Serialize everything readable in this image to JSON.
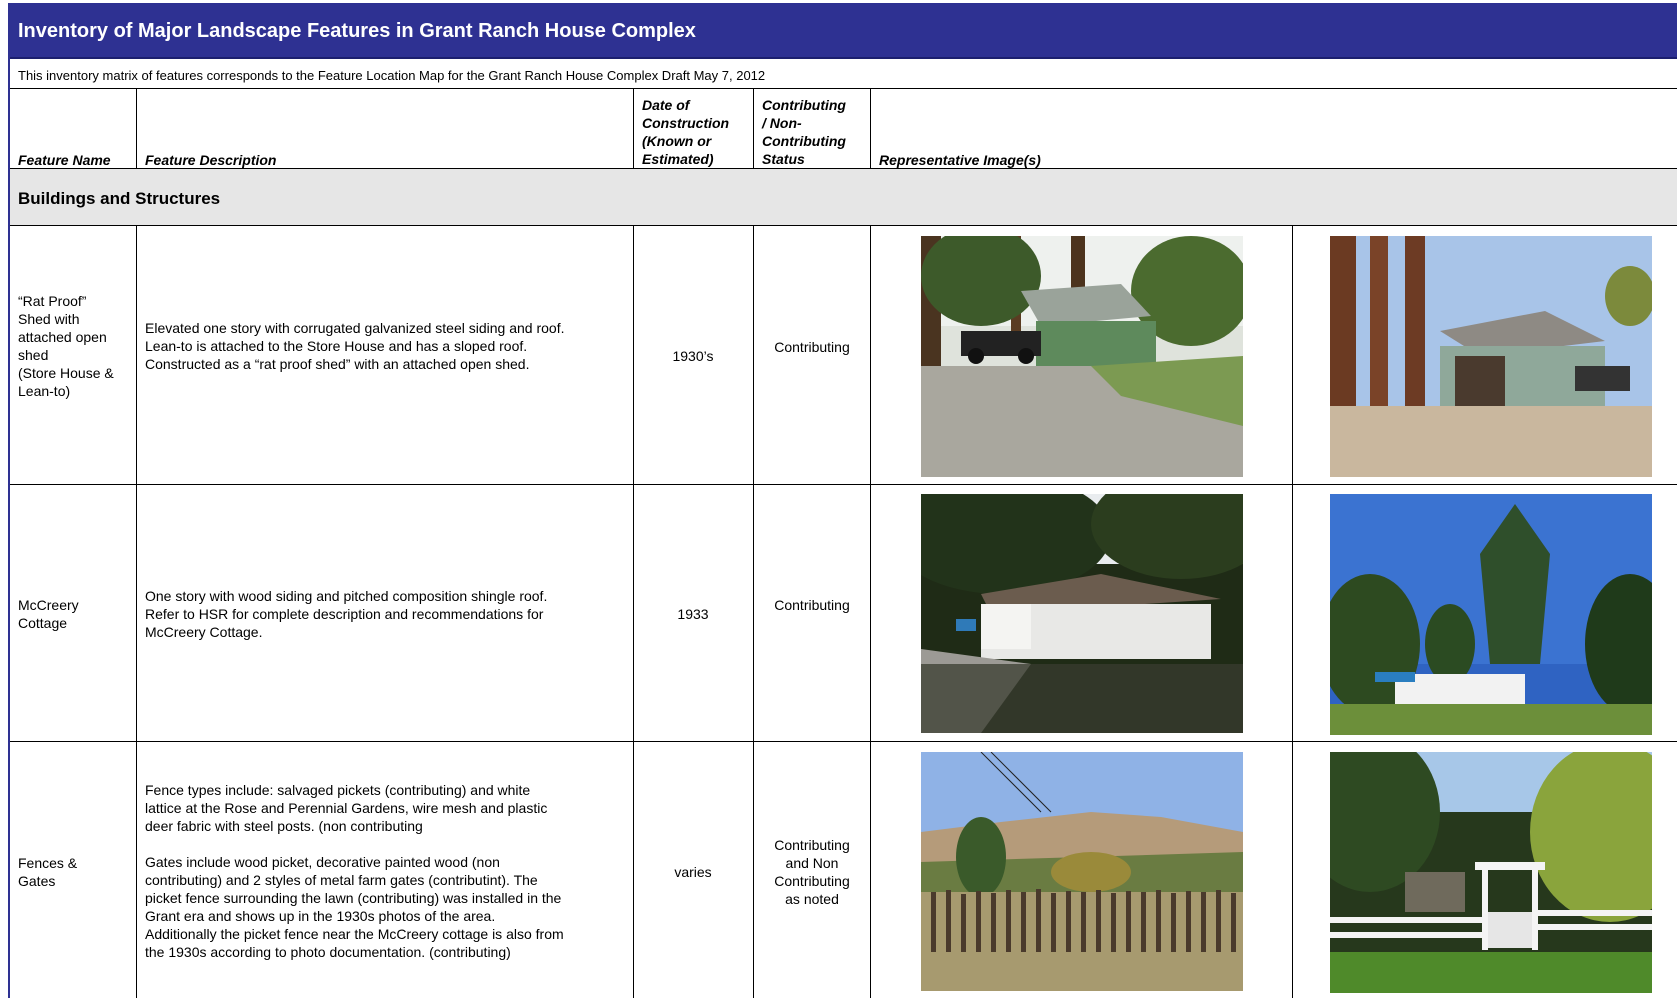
{
  "title": "Inventory of Major Landscape Features in Grant Ranch House Complex",
  "subtitle": "This inventory matrix of features corresponds to the Feature Location Map for the Grant Ranch House Complex  Draft May 7, 2012",
  "headers": {
    "feature_name": "Feature Name",
    "feature_description": "Feature Description",
    "date": [
      "Date of",
      "Construction",
      "(Known or",
      "Estimated)"
    ],
    "status": [
      "Contributing",
      "/ Non-",
      "Contributing",
      "Status"
    ],
    "images": "Representative Image(s)"
  },
  "section": "Buildings and Structures",
  "rows": [
    {
      "name": [
        "“Rat Proof”",
        "Shed with",
        "attached open",
        "shed",
        "(Store House &",
        "Lean-to)"
      ],
      "description": [
        "Elevated one story with corrugated galvanized steel siding and roof.",
        "Lean-to is attached to the Store House and has a sloped roof.",
        "Constructed as a “rat proof shed” with an attached open shed."
      ],
      "date": "1930’s",
      "status": [
        "Contributing"
      ]
    },
    {
      "name": [
        "McCreery",
        "Cottage"
      ],
      "description": [
        "One story with wood siding and pitched composition shingle roof.",
        "Refer to HSR for complete description and recommendations for",
        "McCreery Cottage."
      ],
      "date": "1933",
      "status": [
        "Contributing"
      ]
    },
    {
      "name": [
        "Fences &",
        "Gates"
      ],
      "description": [
        "Fence types include: salvaged pickets (contributing) and white",
        "lattice at the Rose and Perennial Gardens,  wire mesh and plastic",
        "deer fabric with steel posts. (non contributing",
        "",
        "Gates include wood picket, decorative painted wood (non",
        "contributing) and 2 styles of metal farm gates (contributint). The",
        "picket fence surrounding the lawn (contributing) was installed in the",
        "Grant era and shows up in the 1930s photos of the area.",
        "Additionally the picket fence near the McCreery cottage is also from",
        "the 1930s according to photo documentation. (contributing)"
      ],
      "date": "varies",
      "status": [
        "Contributing",
        "and Non",
        "Contributing",
        "as noted"
      ]
    }
  ]
}
